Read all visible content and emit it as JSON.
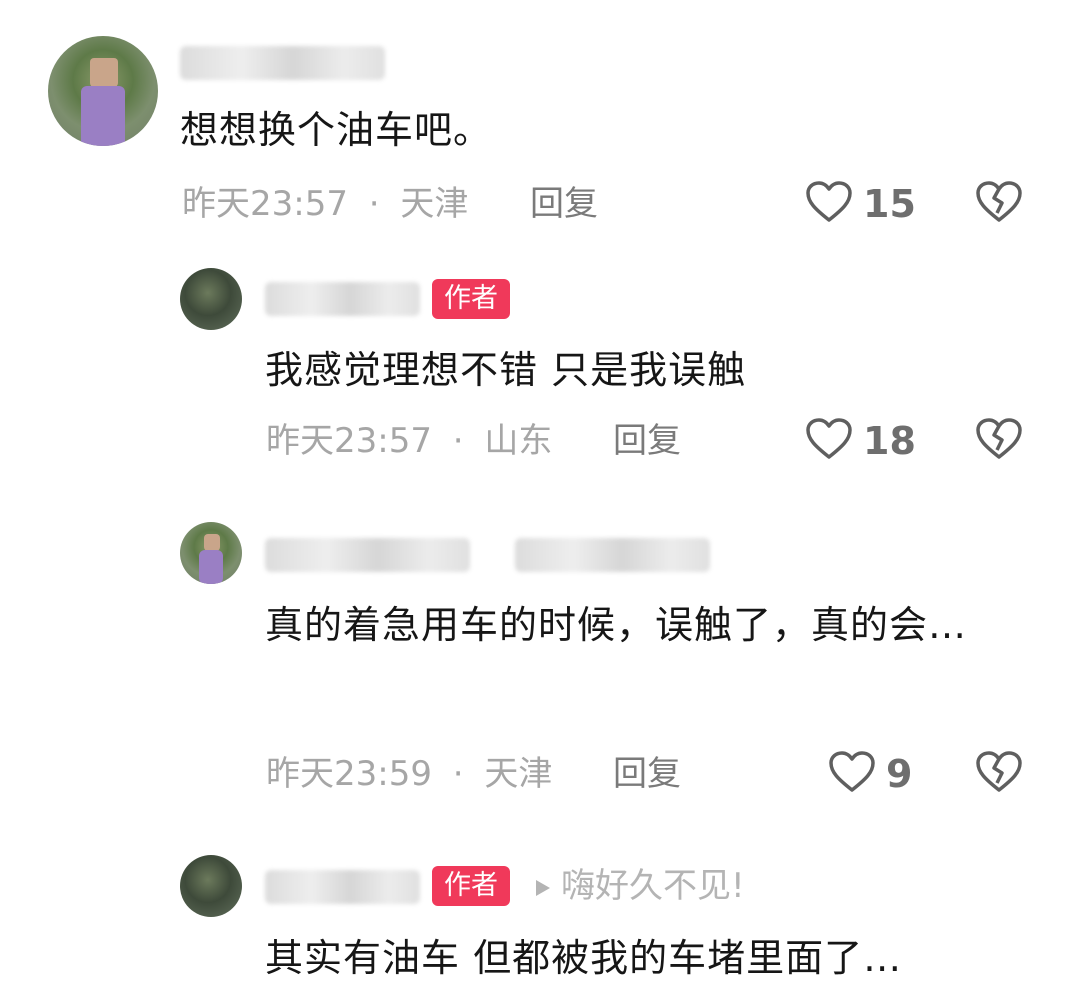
{
  "comments": [
    {
      "text": "想想换个油车吧。",
      "time": "昨天23:57",
      "separator": "·",
      "location": "天津",
      "reply_label": "回复",
      "likes": "15"
    },
    {
      "badge": "作者",
      "text": "我感觉理想不错 只是我误触",
      "time": "昨天23:57",
      "separator": "·",
      "location": "山东",
      "reply_label": "回复",
      "likes": "18"
    },
    {
      "text": "真的着急用车的时候，误触了，真的会…",
      "time": "昨天23:59",
      "separator": "·",
      "location": "天津",
      "reply_label": "回复",
      "likes": "9"
    },
    {
      "badge": "作者",
      "reply_to": "嗨好久不见!",
      "text": "其实有油车 但都被我的车堵里面了…"
    }
  ],
  "icons": {
    "like": "heart-outline-icon",
    "dislike": "broken-heart-icon",
    "reply_arrow": "play-triangle-icon"
  },
  "colors": {
    "author_badge": "#f0395a",
    "meta_text": "#a6a6a6"
  }
}
